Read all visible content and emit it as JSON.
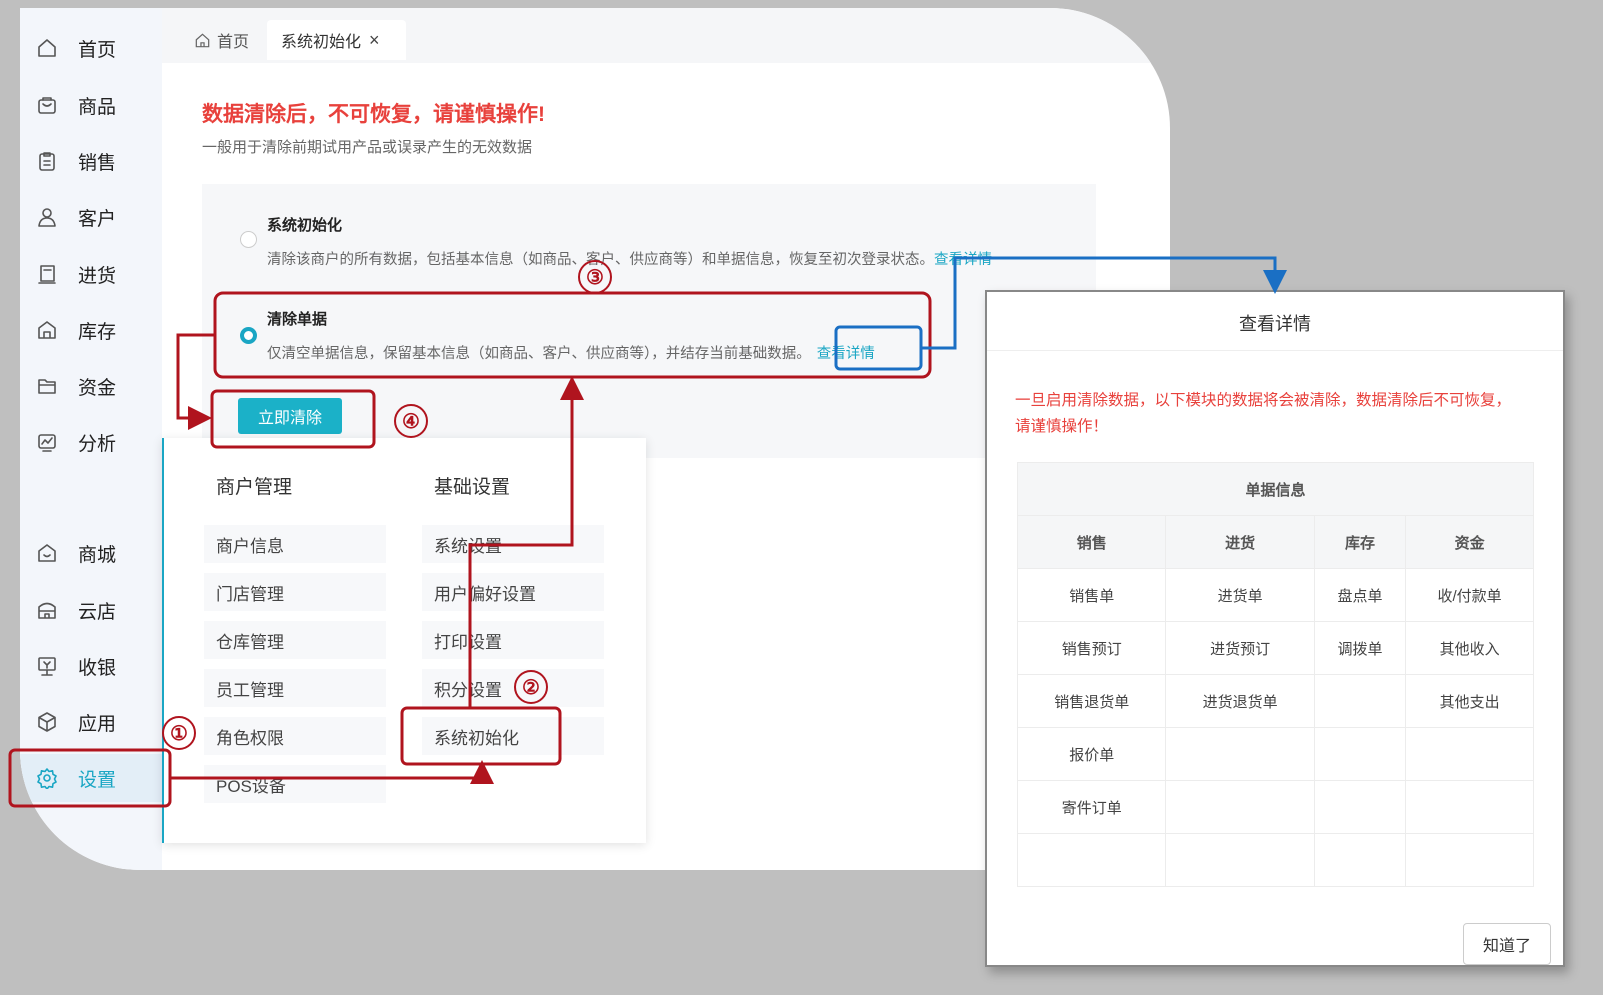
{
  "tabs": [
    {
      "label": "首页",
      "icon": "home-icon"
    },
    {
      "label": "系统初始化",
      "icon": "close-icon",
      "close": "×"
    }
  ],
  "sidebar": {
    "items": [
      {
        "label": "首页",
        "icon": "home-icon"
      },
      {
        "label": "商品",
        "icon": "bag-icon"
      },
      {
        "label": "销售",
        "icon": "clipboard-icon"
      },
      {
        "label": "客户",
        "icon": "user-icon"
      },
      {
        "label": "进货",
        "icon": "book-icon"
      },
      {
        "label": "库存",
        "icon": "warehouse-icon"
      },
      {
        "label": "资金",
        "icon": "folder-icon"
      },
      {
        "label": "分析",
        "icon": "chart-icon"
      },
      {
        "label": "商城",
        "icon": "shop-icon"
      },
      {
        "label": "云店",
        "icon": "store-icon"
      },
      {
        "label": "收银",
        "icon": "cashier-icon"
      },
      {
        "label": "应用",
        "icon": "cube-icon"
      },
      {
        "label": "设置",
        "icon": "gear-icon",
        "active": true
      }
    ]
  },
  "main": {
    "warning_title": "数据清除后，不可恢复，请谨慎操作!",
    "warning_sub": "一般用于清除前期试用产品或误录产生的无效数据",
    "options": [
      {
        "title": "系统初始化",
        "desc": "清除该商户的所有数据，包括基本信息（如商品、客户、供应商等）和单据信息，恢复至初次登录状态。",
        "link": "查看详情",
        "selected": false
      },
      {
        "title": "清除单据",
        "desc": "仅清空单据信息，保留基本信息（如商品、客户、供应商等），并结存当前基础数据。",
        "link": "查看详情",
        "selected": true
      }
    ],
    "clear_button": "立即清除"
  },
  "submenu": {
    "col1": {
      "heading": "商户管理",
      "items": [
        "商户信息",
        "门店管理",
        "仓库管理",
        "员工管理",
        "角色权限",
        "POS设备"
      ]
    },
    "col2": {
      "heading": "基础设置",
      "items": [
        "系统设置",
        "用户偏好设置",
        "打印设置",
        "积分设置",
        "系统初始化"
      ]
    }
  },
  "dialog": {
    "title": "查看详情",
    "warning": "一旦启用清除数据，以下模块的数据将会被清除，数据清除后不可恢复，请谨慎操作！",
    "table_title": "单据信息",
    "columns": [
      "销售",
      "进货",
      "库存",
      "资金"
    ],
    "rows": [
      [
        "销售单",
        "进货单",
        "盘点单",
        "收/付款单"
      ],
      [
        "销售预订",
        "进货预订",
        "调拨单",
        "其他收入"
      ],
      [
        "销售退货单",
        "进货退货单",
        "",
        "其他支出"
      ],
      [
        "报价单",
        "",
        "",
        ""
      ],
      [
        "寄件订单",
        "",
        "",
        ""
      ],
      [
        "",
        "",
        "",
        ""
      ]
    ],
    "ok_button": "知道了"
  },
  "annotations": {
    "steps": [
      "①",
      "②",
      "③",
      "④"
    ],
    "color": "#b0141e",
    "link_color": "#1a6fc4"
  },
  "colors": {
    "accent": "#1aa6c4",
    "warning": "#e8413c"
  }
}
